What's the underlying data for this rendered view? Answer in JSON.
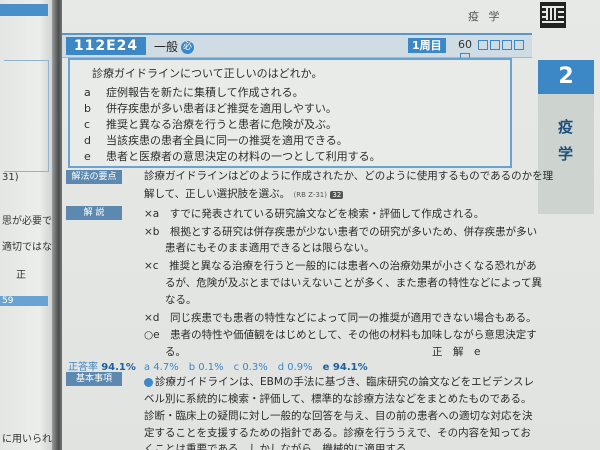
{
  "left_page": {
    "lines": [
      "31)",
      "思が必要で",
      "適切ではな",
      "正",
      "59",
      "に用いられ"
    ]
  },
  "header": {
    "subject": "疫 学"
  },
  "question": {
    "id": "112E24",
    "category": "一般",
    "category_mark": "必",
    "attempt_tag": "1周目",
    "score": "60"
  },
  "stem": "診療ガイドラインについて正しいのはどれか。",
  "choices": [
    {
      "label": "a",
      "text": "症例報告を新たに集積して作成される。"
    },
    {
      "label": "b",
      "text": "併存疾患が多い患者ほど推奨を適用しやすい。"
    },
    {
      "label": "c",
      "text": "推奨と異なる治療を行うと患者に危険が及ぶ。"
    },
    {
      "label": "d",
      "text": "当該疾患の患者全員に同一の推奨を適用できる。"
    },
    {
      "label": "e",
      "text": "患者と医療者の意思決定の材料の一つとして利用する。"
    }
  ],
  "side_tab": {
    "number": "2",
    "label": "疫学"
  },
  "sections": {
    "key_point": "解法の要点",
    "explanation": "解 説",
    "correct_rate_label": "正答率",
    "basic_items": "基本事項"
  },
  "key_point_lines": [
    "診療ガイドラインはどのように作成されたか、どのように使用するものであるのかを理",
    "解して、正しい選択肢を選ぶ。"
  ],
  "key_point_ref": "(RB Z-31)",
  "key_point_badge": "32",
  "explanation_lines": [
    "×a　すでに発表されている研究論文などを検索・評価して作成される。",
    "×b　根拠とする研究は併存疾患が少ない患者での研究が多いため、併存疾患が多い",
    "　　患者にもそのまま適用できるとは限らない。",
    "×c　推奨と異なる治療を行うと一般的には患者への治療効果が小さくなる恐れがあ",
    "　　るが、危険が及ぶとまではいえないことが多く、また患者の特性などによって異",
    "　　なる。",
    "×d　同じ疾患でも患者の特性などによって同一の推奨が適用できない場合もある。",
    "○e　患者の特性や価値観をはじめとして、その他の材料も加味しながら意思決定す",
    "　　る。"
  ],
  "answer": "正　解　e",
  "correct_rate": "94.1%",
  "rates_line": "a 4.7%　b 0.1%　c 0.3%　d 0.9%",
  "rate_e": "e 94.1%",
  "basic_lines": [
    "診療ガイドラインは、EBMの手法に基づき、臨床研究の論文などをエビデンスレ",
    "ベル別に系統的に検索・評価して、標準的な診療方法などをまとめたものである。",
    "診断・臨床上の疑問に対し一般的な回答を与え、目の前の患者への適切な対応を決",
    "定することを支援するための指針である。診療を行ううえで、その内容を知ってお",
    "くことは重要である。しかしながら、機械的に適用する"
  ]
}
